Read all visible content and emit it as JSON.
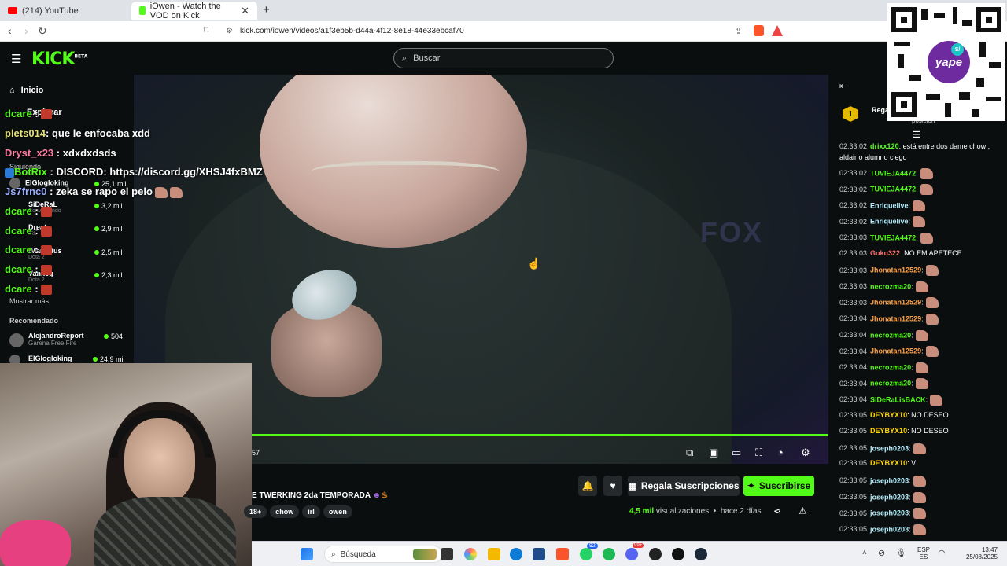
{
  "browser": {
    "tab_inactive": "(214) YouTube",
    "tab_active": "iOwen - Watch the VOD on Kick",
    "new_tab": "+",
    "url": "kick.com/iowen/videos/a1f3eb5b-d44a-4f12-8e18-44e33ebcaf70"
  },
  "header": {
    "logo": "KICK",
    "logo_tag": "BETA",
    "search_placeholder": "Buscar"
  },
  "sidebar": {
    "inicio": "Inicio",
    "explorar": "Explorar",
    "siguiendo": "Siguiendo",
    "following": [
      {
        "name": "ElGlogloking",
        "viewers": "25,1 mil",
        "category": ""
      },
      {
        "name": "SiDeRaL",
        "viewers": "3,2 mil",
        "category": "Conversando"
      },
      {
        "name": "Dreat",
        "viewers": "2,9 mil",
        "category": "IRL"
      },
      {
        "name": "IMarcirius",
        "viewers": "2,5 mil",
        "category": "Dota 2"
      },
      {
        "name": "Vankeg",
        "viewers": "2,3 mil",
        "category": "Dota 2"
      }
    ],
    "show_more": "Mostrar más",
    "recomendado": "Recomendado",
    "recommended": [
      {
        "name": "AlejandroReport",
        "viewers": "504",
        "category": "Garena Free Fire"
      },
      {
        "name": "ElGlogloking",
        "viewers": "24,9 mil",
        "category": ""
      }
    ]
  },
  "overlay_chat": [
    {
      "user": "dcare",
      "text": ":"
    },
    {
      "user": "plets014",
      "text": ": que le enfocaba xdd"
    },
    {
      "user": "Dryst_x23",
      "text": ": xdxdxdsds"
    },
    {
      "user": "BotRix",
      "text": ": DISCORD: https://discord.gg/XHSJ4fxBMZ"
    },
    {
      "user": "Js7frnc0",
      "text": ": zeka se rapo el pelo"
    },
    {
      "user": "dcare",
      "text": ":"
    },
    {
      "user": "dcare",
      "text": ":"
    },
    {
      "user": "dcare",
      "text": ":"
    },
    {
      "user": "dcare",
      "text": ":"
    },
    {
      "user": "dcare",
      "text": ":"
    }
  ],
  "video": {
    "background_text": "FOX",
    "time": "57",
    "progress": 1.0
  },
  "info": {
    "title": "E TWERKING 2da TEMPORADA",
    "tags": [
      "18+",
      "chow",
      "irl",
      "owen"
    ],
    "gift_label": "Regala Suscripciones",
    "subscribe_label": "Suscribirse",
    "views_count": "4,5 mil",
    "views_label": "visualizaciones",
    "ago": "hace 2 días"
  },
  "chat": {
    "top_rank": "1",
    "top_label": "Regala",
    "top_sub": "posición",
    "messages": [
      {
        "time": "02:33:02",
        "user": "drixx120",
        "color": "#53fc18",
        "text": ": está entre dos dame chow , aldair o alumno ciego",
        "emote": false
      },
      {
        "time": "02:33:02",
        "user": "TUVIEJA4472",
        "color": "#53fc18",
        "text": ":",
        "emote": true
      },
      {
        "time": "02:33:02",
        "user": "TUVIEJA4472",
        "color": "#53fc18",
        "text": ":",
        "emote": true
      },
      {
        "time": "02:33:02",
        "user": "Enriquelive",
        "color": "#b6f0ff",
        "text": ":",
        "emote": true
      },
      {
        "time": "02:33:02",
        "user": "Enriquelive",
        "color": "#b6f0ff",
        "text": ":",
        "emote": true
      },
      {
        "time": "02:33:03",
        "user": "TUVIEJA4472",
        "color": "#53fc18",
        "text": ":",
        "emote": true
      },
      {
        "time": "02:33:03",
        "user": "Goku322",
        "color": "#ff6b6b",
        "text": ": NO EM APETECE",
        "emote": false
      },
      {
        "time": "02:33:03",
        "user": "Jhonatan12529",
        "color": "#ff9f43",
        "text": ":",
        "emote": true
      },
      {
        "time": "02:33:03",
        "user": "necrozma20",
        "color": "#53fc18",
        "text": ":",
        "emote": true
      },
      {
        "time": "02:33:03",
        "user": "Jhonatan12529",
        "color": "#ff9f43",
        "text": ":",
        "emote": true
      },
      {
        "time": "02:33:04",
        "user": "Jhonatan12529",
        "color": "#ff9f43",
        "text": ":",
        "emote": true
      },
      {
        "time": "02:33:04",
        "user": "necrozma20",
        "color": "#53fc18",
        "text": ":",
        "emote": true
      },
      {
        "time": "02:33:04",
        "user": "Jhonatan12529",
        "color": "#ff9f43",
        "text": ":",
        "emote": true
      },
      {
        "time": "02:33:04",
        "user": "necrozma20",
        "color": "#53fc18",
        "text": ":",
        "emote": true
      },
      {
        "time": "02:33:04",
        "user": "necrozma20",
        "color": "#53fc18",
        "text": ":",
        "emote": true
      },
      {
        "time": "02:33:04",
        "user": "SiDeRaLisBACK",
        "color": "#53fc18",
        "text": ":",
        "emote": true
      },
      {
        "time": "02:33:05",
        "user": "DEYBYX10",
        "color": "#ffd700",
        "text": ": NO DESEO",
        "emote": false
      },
      {
        "time": "02:33:05",
        "user": "DEYBYX10",
        "color": "#ffd700",
        "text": ": NO DESEO",
        "emote": false
      },
      {
        "time": "02:33:05",
        "user": "joseph0203",
        "color": "#b6f0ff",
        "text": ":",
        "emote": true
      },
      {
        "time": "02:33:05",
        "user": "DEYBYX10",
        "color": "#ffd700",
        "text": ": V",
        "emote": false
      },
      {
        "time": "02:33:05",
        "user": "joseph0203",
        "color": "#b6f0ff",
        "text": ":",
        "emote": true
      },
      {
        "time": "02:33:05",
        "user": "joseph0203",
        "color": "#b6f0ff",
        "text": ":",
        "emote": true
      },
      {
        "time": "02:33:05",
        "user": "joseph0203",
        "color": "#b6f0ff",
        "text": ":",
        "emote": true
      },
      {
        "time": "02:33:05",
        "user": "joseph0203",
        "color": "#b6f0ff",
        "text": ":",
        "emote": true
      }
    ]
  },
  "qr": {
    "brand": "yape",
    "currency": "S/"
  },
  "taskbar": {
    "search": "Búsqueda",
    "whatsapp_badge": "92",
    "discord_badge": "99+",
    "lang1": "ESP",
    "lang2": "ES",
    "time": "13:47",
    "date": "25/08/2025"
  },
  "colors": {
    "kick_green": "#53fc18",
    "bg": "#0b0e0f"
  }
}
